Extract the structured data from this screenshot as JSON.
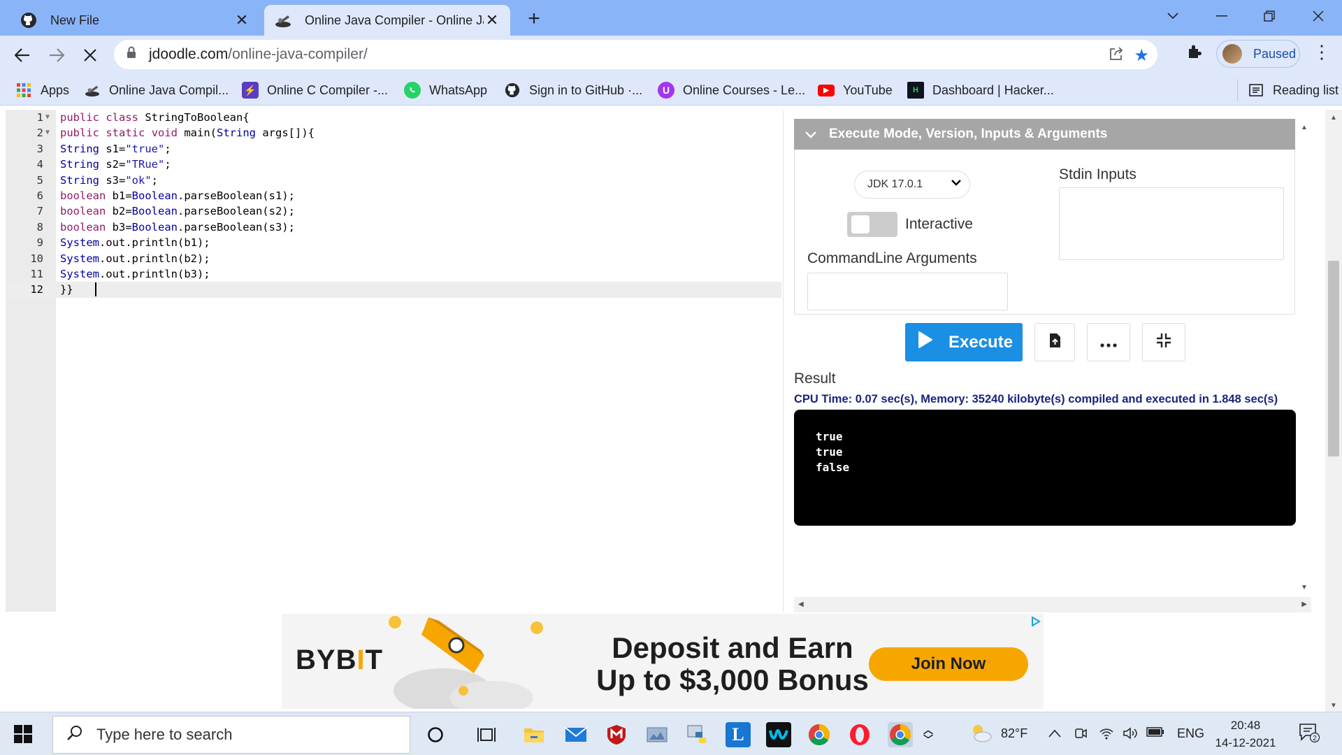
{
  "browser": {
    "tabs": [
      {
        "title": "New File",
        "icon": "github-icon",
        "active": false
      },
      {
        "title": "Online Java Compiler - Online Ja",
        "icon": "jdoodle-icon",
        "active": true
      }
    ],
    "new_tab": "+",
    "address": {
      "host": "jdoodle.com",
      "path": "/online-java-compiler/"
    },
    "profile_status": "Paused",
    "bookmarks": [
      {
        "label": "Apps",
        "icon": "apps-grid-icon"
      },
      {
        "label": "Online Java Compil...",
        "icon": "jdoodle-icon"
      },
      {
        "label": "Online C Compiler -...",
        "icon": "bolt-icon"
      },
      {
        "label": "WhatsApp",
        "icon": "whatsapp-icon"
      },
      {
        "label": "Sign in to GitHub ·...",
        "icon": "github-icon"
      },
      {
        "label": "Online Courses - Le...",
        "icon": "udemy-icon"
      },
      {
        "label": "YouTube",
        "icon": "youtube-icon"
      },
      {
        "label": "Dashboard | Hacker...",
        "icon": "hackerrank-icon"
      }
    ],
    "reading_list": "Reading list"
  },
  "editor": {
    "lines": [
      {
        "n": "1",
        "fold": true,
        "tokens": [
          [
            "kw",
            "public"
          ],
          [
            "t",
            " "
          ],
          [
            "kw",
            "class"
          ],
          [
            "t",
            " StringToBoolean{"
          ]
        ]
      },
      {
        "n": "2",
        "fold": true,
        "tokens": [
          [
            "kw",
            "public"
          ],
          [
            "t",
            " "
          ],
          [
            "kw",
            "static"
          ],
          [
            "t",
            " "
          ],
          [
            "kw",
            "void"
          ],
          [
            "t",
            " main("
          ],
          [
            "ty",
            "String"
          ],
          [
            "t",
            " args[]){"
          ]
        ]
      },
      {
        "n": "3",
        "fold": false,
        "tokens": [
          [
            "ty",
            "String"
          ],
          [
            "t",
            " s1="
          ],
          [
            "st",
            "\"true\""
          ],
          [
            "t",
            ";"
          ]
        ]
      },
      {
        "n": "4",
        "fold": false,
        "tokens": [
          [
            "ty",
            "String"
          ],
          [
            "t",
            " s2="
          ],
          [
            "st",
            "\"TRue\""
          ],
          [
            "t",
            ";"
          ]
        ]
      },
      {
        "n": "5",
        "fold": false,
        "tokens": [
          [
            "ty",
            "String"
          ],
          [
            "t",
            " s3="
          ],
          [
            "st",
            "\"ok\""
          ],
          [
            "t",
            ";"
          ]
        ]
      },
      {
        "n": "6",
        "fold": false,
        "tokens": [
          [
            "kw",
            "boolean"
          ],
          [
            "t",
            " b1="
          ],
          [
            "ty",
            "Boolean"
          ],
          [
            "t",
            ".parseBoolean(s1);"
          ]
        ]
      },
      {
        "n": "7",
        "fold": false,
        "tokens": [
          [
            "kw",
            "boolean"
          ],
          [
            "t",
            " b2="
          ],
          [
            "ty",
            "Boolean"
          ],
          [
            "t",
            ".parseBoolean(s2);"
          ]
        ]
      },
      {
        "n": "8",
        "fold": false,
        "tokens": [
          [
            "kw",
            "boolean"
          ],
          [
            "t",
            " b3="
          ],
          [
            "ty",
            "Boolean"
          ],
          [
            "t",
            ".parseBoolean(s3);"
          ]
        ]
      },
      {
        "n": "9",
        "fold": false,
        "tokens": [
          [
            "ty",
            "System"
          ],
          [
            "t",
            ".out.println(b1);"
          ]
        ]
      },
      {
        "n": "10",
        "fold": false,
        "tokens": [
          [
            "ty",
            "System"
          ],
          [
            "t",
            ".out.println(b2);"
          ]
        ]
      },
      {
        "n": "11",
        "fold": false,
        "tokens": [
          [
            "ty",
            "System"
          ],
          [
            "t",
            ".out.println(b3);"
          ]
        ]
      },
      {
        "n": "12",
        "fold": false,
        "active": true,
        "tokens": [
          [
            "t",
            "}} "
          ]
        ]
      }
    ]
  },
  "panel": {
    "header": "Execute Mode, Version, Inputs & Arguments",
    "jdk_version": "JDK 17.0.1",
    "interactive_label": "Interactive",
    "interactive_on": false,
    "stdin_label": "Stdin Inputs",
    "args_label": "CommandLine Arguments",
    "execute_label": "Execute",
    "result_label": "Result",
    "stats": "CPU Time: 0.07 sec(s), Memory: 35240 kilobyte(s) compiled and executed in 1.848 sec(s)",
    "output": [
      "true",
      "true",
      "false"
    ]
  },
  "ad": {
    "brand": "BYB",
    "brand_accent": "I",
    "brand_end": "T",
    "headline_1": "Deposit and Earn",
    "headline_2": "Up to $3,000 Bonus",
    "cta": "Join Now"
  },
  "taskbar": {
    "search_placeholder": "Type here to search",
    "weather": "82°F",
    "language": "ENG",
    "time": "20:48",
    "date": "14-12-2021",
    "notifications": "2"
  },
  "colors": {
    "chrome_frame": "#8ab4f8",
    "toolbar": "#dfe8fb",
    "execute_button": "#1a8fe3",
    "params_header": "#a6a6a6",
    "ad_accent": "#f7a600"
  }
}
